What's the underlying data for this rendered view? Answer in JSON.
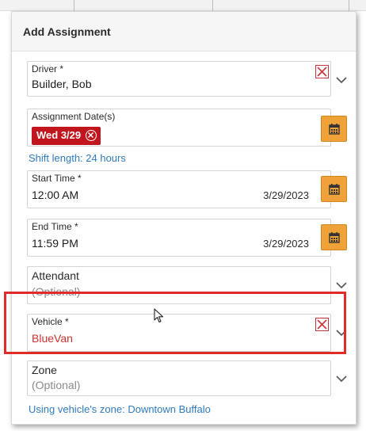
{
  "dialog": {
    "title": "Add Assignment"
  },
  "driver": {
    "label": "Driver *",
    "value": "Builder, Bob"
  },
  "assignment_dates": {
    "label": "Assignment Date(s)",
    "chip": "Wed 3/29"
  },
  "shift_length": "Shift length: 24 hours",
  "start_time": {
    "label": "Start Time *",
    "time": "12:00 AM",
    "date": "3/29/2023"
  },
  "end_time": {
    "label": "End Time *",
    "time": "11:59 PM",
    "date": "3/29/2023"
  },
  "attendant": {
    "label": "Attendant",
    "placeholder": "(Optional)"
  },
  "vehicle": {
    "label": "Vehicle *",
    "value": "BlueVan"
  },
  "zone": {
    "label": "Zone",
    "placeholder": "(Optional)"
  },
  "zone_note": "Using vehicle's zone: Downtown Buffalo",
  "colors": {
    "accent_orange": "#f0a23a",
    "chip_red": "#c1161d",
    "link_blue": "#2f7bbd",
    "highlight_red": "#e02b2b",
    "vehicle_value_red": "#d0302e"
  },
  "icons": {
    "clear": "close-x-icon",
    "dropdown": "chevron-down-icon",
    "calendar": "calendar-icon",
    "cursor": "mouse-pointer-icon"
  }
}
